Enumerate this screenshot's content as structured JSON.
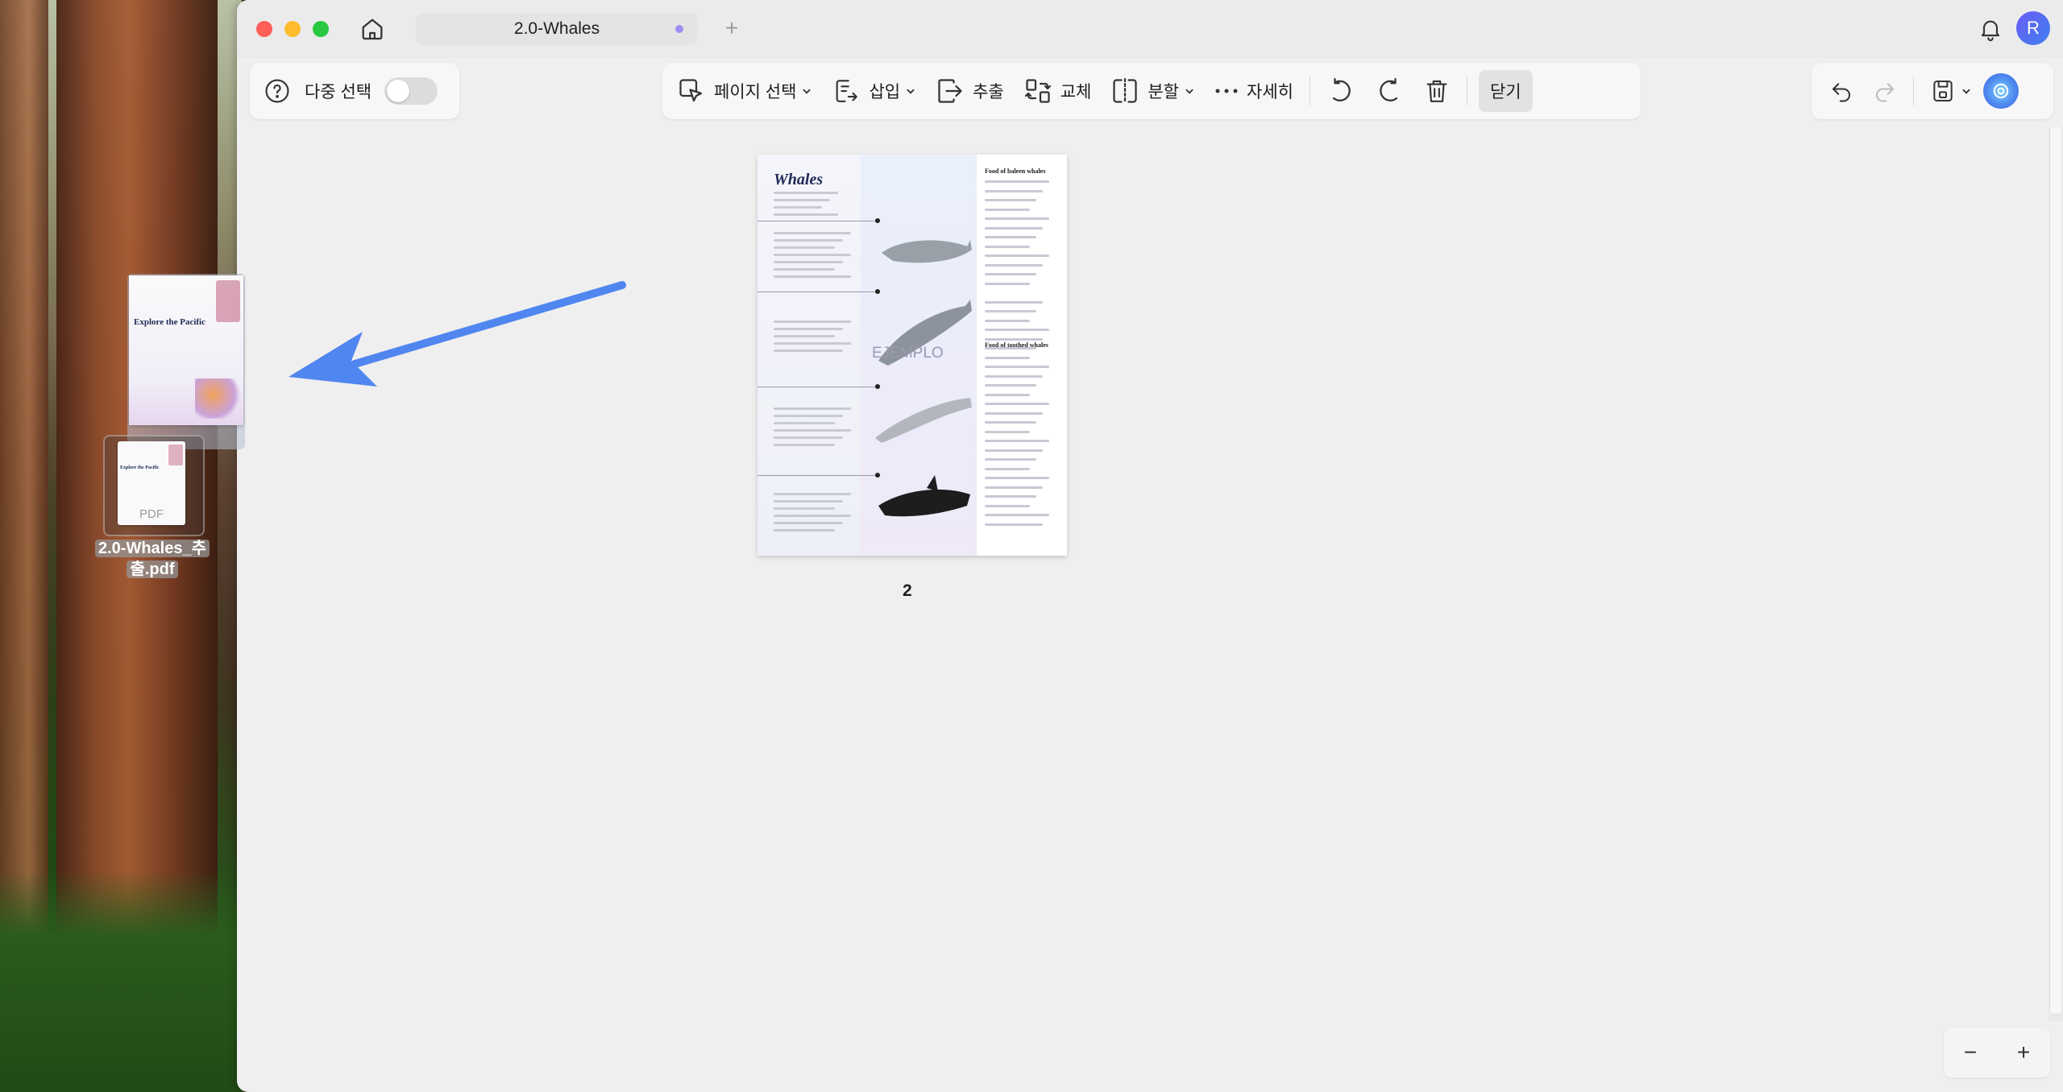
{
  "window": {
    "tab_title": "2.0-Whales",
    "new_tab": "+",
    "avatar_initial": "R",
    "accent": "#4f8af0"
  },
  "toolbar_left": {
    "multi_select_label": "다중 선택",
    "toggle_on": false
  },
  "toolbar_center": {
    "page_select": "페이지 선택",
    "insert": "삽입",
    "extract": "추출",
    "replace": "교체",
    "split": "분할",
    "more": "자세히",
    "close": "닫기"
  },
  "page": {
    "title": "Whales",
    "food_baleen": "Food of baleen whales",
    "food_toothed": "Food of toothed whales",
    "watermark": "EJEMPLO",
    "number": "2"
  },
  "desktop": {
    "preview_title": "Explore the Pacific",
    "file_title": "Explore the Pacific",
    "file_ext": "PDF",
    "file_name_line1": "2.0-Whales_추",
    "file_name_line2": "출.pdf"
  },
  "zoom": {
    "minus": "−",
    "plus": "+"
  }
}
